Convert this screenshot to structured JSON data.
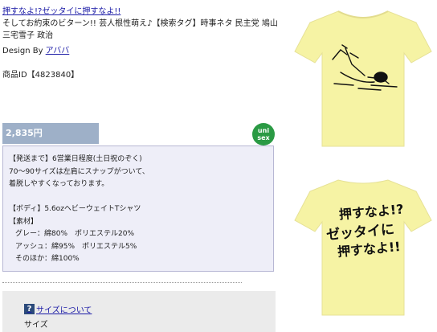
{
  "product": {
    "title": "押すなよ!?ゼッタイに押すなよ!!",
    "description": "そしてお約束のビターン!! 芸人根性萌え♪【検索タグ】時事ネタ 民主党 鳩山 三宅雪子 政治",
    "design_by_label": "Design By",
    "designer": "アババ",
    "item_id_label": "商品ID【4823840】",
    "price": "2,835円",
    "unisex_badge": [
      "uni",
      "sex"
    ]
  },
  "info": {
    "lines_1": [
      "【発送まで】6営業日程度(土日祝のぞく)",
      "70～90サイズは左肩にスナップがついて、",
      "着脱しやすくなっております。"
    ],
    "lines_2": [
      "【ボディ】5.6ozヘビーウェイトTシャツ",
      "【素材】"
    ],
    "materials": [
      "グレー：綿80%　ポリエステル20%",
      "アッシュ：綿95%　ポリエステル5%",
      "そのほか：綿100%"
    ]
  },
  "size": {
    "help_icon": "?",
    "link_label": "サイズについて",
    "label": "サイズ"
  },
  "shirt_back_text": [
    "押すなよ!?",
    "ゼッタイに",
    "押すなよ!!"
  ],
  "colors": {
    "shirt": "#f6f3a4",
    "price_bar": "#9eb0c8",
    "unisex": "#2a9a44",
    "link": "#1a1aa6"
  }
}
